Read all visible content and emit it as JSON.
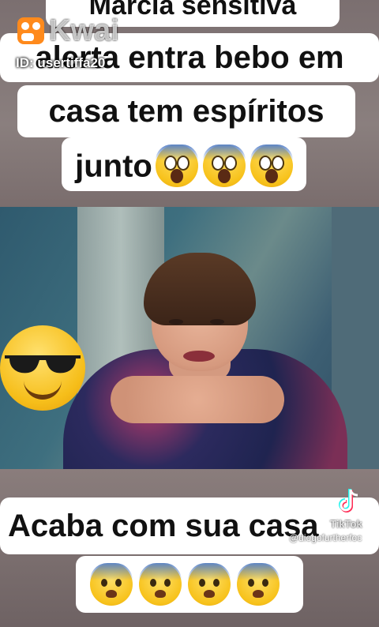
{
  "captions": {
    "line1": "Marcia sensitiva",
    "line2": "alerta entra bebo em",
    "line3": "casa tem espíritos",
    "line4": "junto",
    "bottom_line1": "Acaba com sua casa",
    "line4_emojis": [
      "face-screaming-in-fear",
      "face-screaming-in-fear",
      "face-screaming-in-fear"
    ],
    "bottom_emojis": [
      "hushed-worried-face",
      "hushed-worried-face",
      "hushed-worried-face",
      "hushed-worried-face"
    ]
  },
  "overlay_emoji": "smiling-face-with-sunglasses",
  "watermarks": {
    "kwai_brand": "Kwai",
    "kwai_id": "ID: usertiffa20",
    "tiktok_brand": "TikTok",
    "tiktok_user": "@diogofurtherfoc"
  },
  "colors": {
    "caption_bg": "#ffffff",
    "caption_text": "#111111",
    "kwai_orange": "#ff8a1c",
    "emoji_yellow": "#f7c21b"
  }
}
